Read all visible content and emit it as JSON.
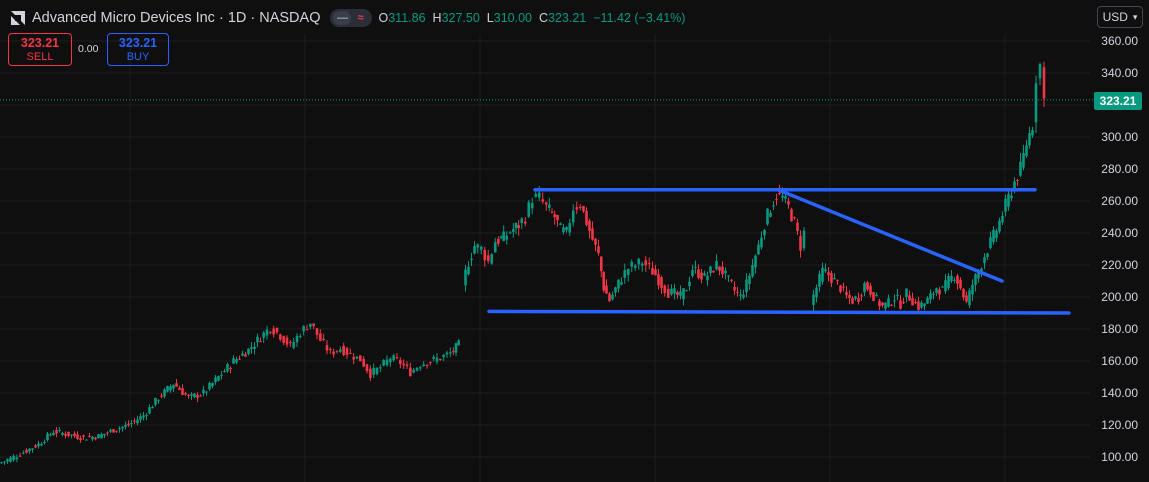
{
  "header": {
    "title": "Advanced Micro Devices Inc · 1D · NASDAQ",
    "ohlc": [
      {
        "key": "O",
        "value": "311.86"
      },
      {
        "key": "H",
        "value": "327.50"
      },
      {
        "key": "L",
        "value": "310.00"
      },
      {
        "key": "C",
        "value": "323.21"
      }
    ],
    "change": "−11.42 (−3.41%)"
  },
  "trade": {
    "sell_price": "323.21",
    "sell_label": "SELL",
    "spread": "0.00",
    "buy_price": "323.21",
    "buy_label": "BUY"
  },
  "currency": "USD",
  "last_price": "323.21",
  "colors": {
    "background": "#0f0f0f",
    "up": "#089981",
    "down": "#f23645",
    "trendline": "#2962ff",
    "accent": "#2962ff"
  },
  "chart_data": {
    "type": "candlestick",
    "symbol": "Advanced Micro Devices Inc",
    "interval": "1D",
    "ylim": [
      90,
      367
    ],
    "yticks": [
      "100.00",
      "120.00",
      "140.00",
      "160.00",
      "180.00",
      "200.00",
      "220.00",
      "240.00",
      "260.00",
      "280.00",
      "300.00",
      "320.00",
      "340.00",
      "360.00"
    ],
    "last_close": 323.21,
    "grid": true,
    "series": [
      {
        "name": "segment-1",
        "points": [
          [
            0,
            96
          ],
          [
            12,
            99
          ],
          [
            25,
            103
          ],
          [
            40,
            108
          ],
          [
            55,
            116
          ],
          [
            70,
            114
          ],
          [
            85,
            112
          ],
          [
            100,
            113
          ],
          [
            115,
            117
          ],
          [
            130,
            120
          ],
          [
            145,
            126
          ],
          [
            160,
            137
          ],
          [
            175,
            146
          ],
          [
            190,
            137
          ],
          [
            205,
            140
          ],
          [
            220,
            150
          ],
          [
            235,
            160
          ],
          [
            250,
            167
          ],
          [
            262,
            175
          ],
          [
            272,
            181
          ],
          [
            282,
            176
          ],
          [
            292,
            169
          ],
          [
            302,
            178
          ],
          [
            312,
            184
          ],
          [
            322,
            173
          ],
          [
            332,
            165
          ],
          [
            342,
            168
          ],
          [
            352,
            164
          ],
          [
            362,
            161
          ],
          [
            372,
            152
          ],
          [
            382,
            156
          ],
          [
            392,
            162
          ],
          [
            402,
            159
          ],
          [
            412,
            153
          ],
          [
            422,
            158
          ],
          [
            432,
            160
          ],
          [
            442,
            162
          ],
          [
            452,
            165
          ],
          [
            460,
            170
          ]
        ]
      },
      {
        "name": "segment-2",
        "points": [
          [
            464,
            208
          ],
          [
            470,
            222
          ],
          [
            476,
            232
          ],
          [
            483,
            230
          ],
          [
            490,
            222
          ],
          [
            497,
            235
          ],
          [
            505,
            237
          ],
          [
            512,
            241
          ],
          [
            520,
            245
          ],
          [
            527,
            250
          ],
          [
            534,
            262
          ],
          [
            541,
            262
          ],
          [
            548,
            256
          ],
          [
            556,
            250
          ],
          [
            562,
            242
          ],
          [
            568,
            240
          ],
          [
            575,
            256
          ],
          [
            582,
            258
          ],
          [
            588,
            247
          ],
          [
            594,
            236
          ],
          [
            600,
            226
          ],
          [
            605,
            206
          ],
          [
            611,
            198
          ],
          [
            617,
            205
          ],
          [
            623,
            212
          ],
          [
            630,
            218
          ],
          [
            637,
            220
          ],
          [
            644,
            222
          ],
          [
            651,
            218
          ],
          [
            657,
            214
          ],
          [
            663,
            208
          ],
          [
            670,
            203
          ],
          [
            676,
            202
          ],
          [
            682,
            200
          ],
          [
            688,
            206
          ],
          [
            694,
            218
          ],
          [
            700,
            215
          ],
          [
            706,
            212
          ],
          [
            712,
            216
          ],
          [
            718,
            220
          ],
          [
            724,
            216
          ],
          [
            730,
            210
          ],
          [
            736,
            204
          ],
          [
            742,
            200
          ],
          [
            748,
            208
          ],
          [
            754,
            220
          ],
          [
            760,
            232
          ],
          [
            766,
            246
          ],
          [
            772,
            256
          ],
          [
            778,
            264
          ],
          [
            784,
            262
          ],
          [
            790,
            256
          ],
          [
            796,
            246
          ],
          [
            802,
            232
          ],
          [
            806,
            240
          ]
        ]
      },
      {
        "name": "segment-3",
        "points": [
          [
            812,
            196
          ],
          [
            818,
            206
          ],
          [
            824,
            216
          ],
          [
            830,
            214
          ],
          [
            836,
            210
          ],
          [
            842,
            206
          ],
          [
            848,
            200
          ],
          [
            854,
            198
          ],
          [
            860,
            200
          ],
          [
            866,
            208
          ],
          [
            872,
            204
          ],
          [
            878,
            198
          ],
          [
            884,
            194
          ],
          [
            890,
            196
          ],
          [
            896,
            200
          ],
          [
            902,
            196
          ],
          [
            908,
            202
          ],
          [
            914,
            198
          ],
          [
            920,
            194
          ],
          [
            926,
            196
          ],
          [
            932,
            200
          ],
          [
            938,
            206
          ],
          [
            944,
            204
          ],
          [
            950,
            210
          ],
          [
            956,
            214
          ],
          [
            962,
            206
          ],
          [
            968,
            196
          ],
          [
            974,
            208
          ],
          [
            980,
            216
          ],
          [
            986,
            226
          ],
          [
            992,
            234
          ],
          [
            998,
            242
          ],
          [
            1004,
            252
          ],
          [
            1010,
            262
          ],
          [
            1016,
            272
          ],
          [
            1022,
            280
          ],
          [
            1028,
            296
          ],
          [
            1034,
            308
          ],
          [
            1038,
            338
          ],
          [
            1042,
            345
          ],
          [
            1046,
            323
          ]
        ]
      }
    ],
    "annotations": [
      {
        "type": "trendline",
        "from": [
          535,
          267
        ],
        "to": [
          1035,
          267
        ],
        "label": ""
      },
      {
        "type": "trendline",
        "from": [
          778,
          267
        ],
        "to": [
          1002,
          210
        ],
        "label": ""
      },
      {
        "type": "trendline",
        "from": [
          489,
          191
        ],
        "to": [
          1069,
          190
        ],
        "label": ""
      }
    ]
  }
}
